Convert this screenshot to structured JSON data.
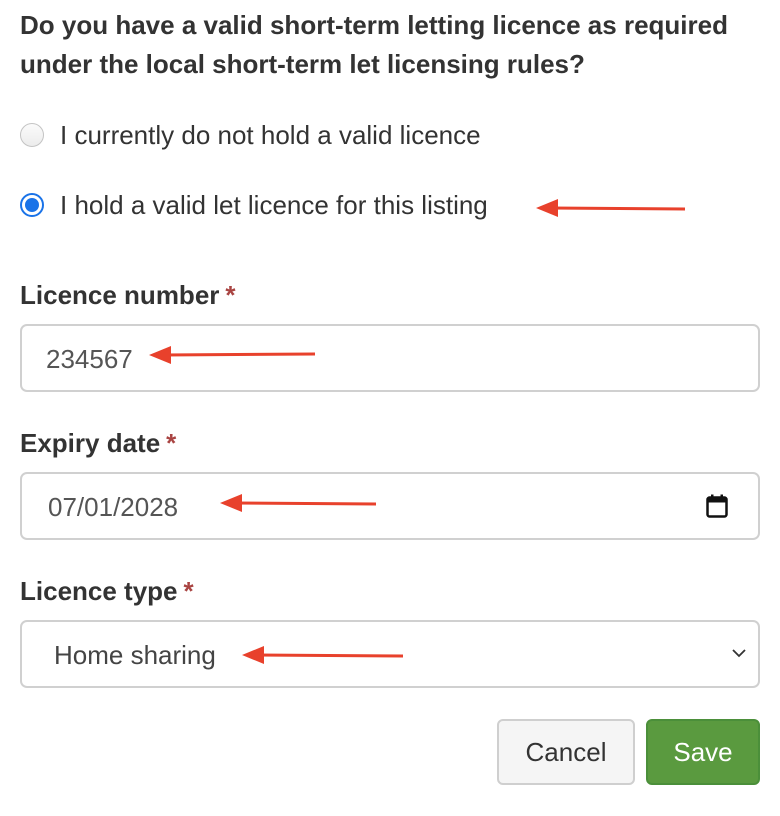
{
  "question": "Do you have a valid short-term letting licence as required under the local short-term let licensing rules?",
  "radio_options": [
    {
      "label": "I currently do not hold a valid licence",
      "checked": false
    },
    {
      "label": "I hold a valid let licence for this listing",
      "checked": true
    }
  ],
  "fields": {
    "licence_number": {
      "label": "Licence number",
      "required_marker": "*",
      "value": "234567"
    },
    "expiry_date": {
      "label": "Expiry date",
      "required_marker": "*",
      "value": "07/01/2028",
      "icon": "calendar-icon"
    },
    "licence_type": {
      "label": "Licence type",
      "required_marker": "*",
      "selected": "Home sharing",
      "icon": "chevron-down-icon"
    }
  },
  "buttons": {
    "cancel": "Cancel",
    "save": "Save"
  },
  "colors": {
    "annotation_arrow": "#e8412c",
    "radio_selected": "#1a73e8",
    "save_button": "#5a9a3f",
    "required_marker": "#a94442"
  }
}
